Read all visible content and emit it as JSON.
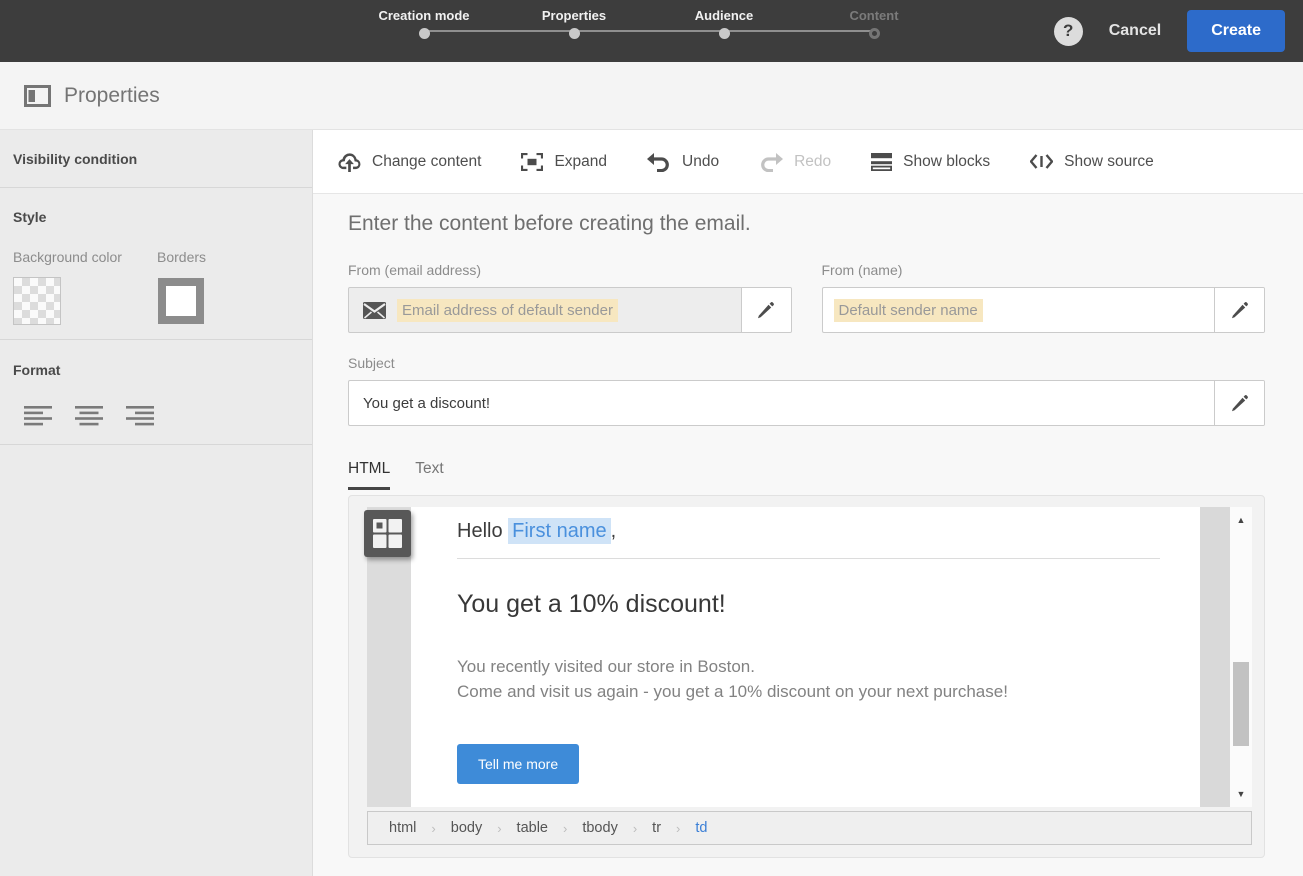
{
  "wizard": {
    "steps": [
      {
        "label": "Creation mode",
        "state": "done"
      },
      {
        "label": "Properties",
        "state": "done"
      },
      {
        "label": "Audience",
        "state": "done"
      },
      {
        "label": "Content",
        "state": "upcoming"
      }
    ],
    "help_label": "?",
    "cancel_label": "Cancel",
    "create_label": "Create",
    "create_color": "#2d6bca"
  },
  "header": {
    "title": "Properties",
    "icon": "panel-layout-icon"
  },
  "sidebar": {
    "visibility_section": {
      "title": "Visibility condition"
    },
    "style_section": {
      "title": "Style",
      "background_color_label": "Background color",
      "background_color_value": "transparent",
      "borders_label": "Borders"
    },
    "format_section": {
      "title": "Format",
      "alignments": [
        "align-left",
        "align-center",
        "align-right"
      ]
    }
  },
  "toolbar": {
    "items": [
      {
        "label": "Change content",
        "icon": "cloud-upload-icon",
        "enabled": true
      },
      {
        "label": "Expand",
        "icon": "expand-icon",
        "enabled": true
      },
      {
        "label": "Undo",
        "icon": "undo-arrow-icon",
        "enabled": true
      },
      {
        "label": "Redo",
        "icon": "redo-arrow-icon",
        "enabled": false
      },
      {
        "label": "Show blocks",
        "icon": "blocks-icon",
        "enabled": true
      },
      {
        "label": "Show source",
        "icon": "code-icon",
        "enabled": true
      }
    ]
  },
  "content": {
    "heading": "Enter the content before creating the email.",
    "from_email": {
      "label": "From (email address)",
      "placeholder": "Email address of default sender"
    },
    "from_name": {
      "label": "From (name)",
      "placeholder": "Default sender name"
    },
    "subject": {
      "label": "Subject",
      "value": "You get a discount!"
    },
    "tabs": [
      {
        "label": "HTML",
        "active": true
      },
      {
        "label": "Text",
        "active": false
      }
    ]
  },
  "email_preview": {
    "greeting_prefix": "Hello ",
    "personalization_token": "First name",
    "greeting_suffix": ",",
    "headline": "You get a 10% discount!",
    "body_lines": [
      "You recently visited our store in Boston.",
      "Come and visit us again - you get a 10% discount on your next purchase!"
    ],
    "cta_label": "Tell me more",
    "token_color": "#4a90dd",
    "token_bg": "#cfe3f7",
    "cta_color": "#3e8bd8"
  },
  "breadcrumb": {
    "items": [
      "html",
      "body",
      "table",
      "tbody",
      "tr",
      "td"
    ],
    "active_item": "td",
    "active_color": "#3b7fd6"
  }
}
